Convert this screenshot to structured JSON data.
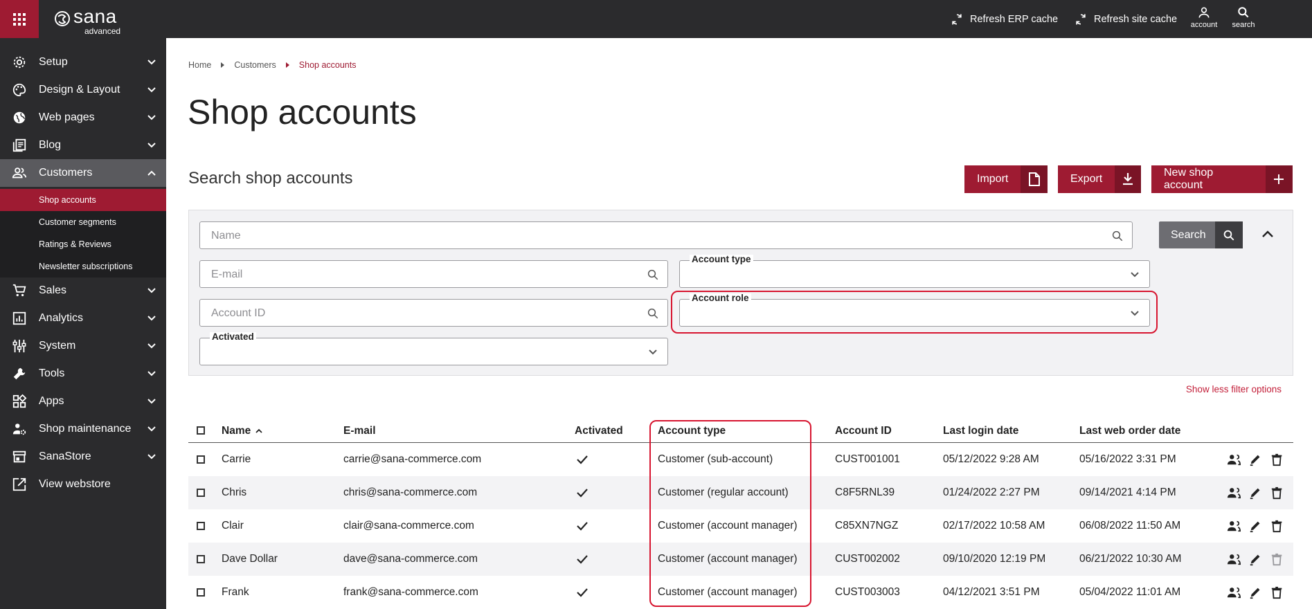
{
  "topbar": {
    "logo_word": "sana",
    "logo_sub": "advanced",
    "refresh_erp": "Refresh ERP cache",
    "refresh_site": "Refresh site cache",
    "account_label": "account",
    "search_label": "search"
  },
  "sidebar": {
    "items": [
      {
        "label": "Setup",
        "icon": "gear-icon"
      },
      {
        "label": "Design & Layout",
        "icon": "palette-icon"
      },
      {
        "label": "Web pages",
        "icon": "globe-icon"
      },
      {
        "label": "Blog",
        "icon": "blog-icon"
      },
      {
        "label": "Customers",
        "icon": "people-icon"
      },
      {
        "label": "Sales",
        "icon": "cart-icon"
      },
      {
        "label": "Analytics",
        "icon": "chart-icon"
      },
      {
        "label": "System",
        "icon": "sliders-icon"
      },
      {
        "label": "Tools",
        "icon": "wrench-icon"
      },
      {
        "label": "Apps",
        "icon": "apps-icon"
      },
      {
        "label": "Shop maintenance",
        "icon": "user-gear-icon"
      },
      {
        "label": "SanaStore",
        "icon": "store-icon"
      },
      {
        "label": "View webstore",
        "icon": "external-link-icon"
      }
    ],
    "sub_items": [
      "Shop accounts",
      "Customer segments",
      "Ratings & Reviews",
      "Newsletter subscriptions"
    ]
  },
  "breadcrumb": [
    "Home",
    "Customers",
    "Shop accounts"
  ],
  "page_title": "Shop accounts",
  "section_title": "Search shop accounts",
  "buttons": {
    "import": "Import",
    "export": "Export",
    "new": "New shop account"
  },
  "filters": {
    "name_placeholder": "Name",
    "email_placeholder": "E-mail",
    "account_id_placeholder": "Account ID",
    "account_type_label": "Account type",
    "account_role_label": "Account role",
    "activated_label": "Activated",
    "search_button": "Search",
    "toggle_link": "Show less filter options"
  },
  "table": {
    "columns": [
      "Name",
      "E-mail",
      "Activated",
      "Account type",
      "Account ID",
      "Last login date",
      "Last web order date"
    ],
    "rows": [
      {
        "name": "Carrie",
        "email": "carrie@sana-commerce.com",
        "activated": true,
        "type": "Customer (sub-account)",
        "id": "CUST001001",
        "login": "05/12/2022 9:28 AM",
        "order": "05/16/2022 3:31 PM"
      },
      {
        "name": "Chris",
        "email": "chris@sana-commerce.com",
        "activated": true,
        "type": "Customer (regular account)",
        "id": "C8F5RNL39",
        "login": "01/24/2022 2:27 PM",
        "order": "09/14/2021 4:14 PM"
      },
      {
        "name": "Clair",
        "email": "clair@sana-commerce.com",
        "activated": true,
        "type": "Customer (account manager)",
        "id": "C85XN7NGZ",
        "login": "02/17/2022 10:58 AM",
        "order": "06/08/2022 11:50 AM"
      },
      {
        "name": "Dave Dollar",
        "email": "dave@sana-commerce.com",
        "activated": true,
        "type": "Customer (account manager)",
        "id": "CUST002002",
        "login": "09/10/2020 12:19 PM",
        "order": "06/21/2022 10:30 AM"
      },
      {
        "name": "Frank",
        "email": "frank@sana-commerce.com",
        "activated": true,
        "type": "Customer (account manager)",
        "id": "CUST003003",
        "login": "04/12/2021 3:51 PM",
        "order": "05/04/2022 11:01 AM"
      }
    ]
  },
  "colors": {
    "brand": "#9e1b32",
    "sidebar": "#2b2b2d",
    "highlight": "#d7152f"
  }
}
